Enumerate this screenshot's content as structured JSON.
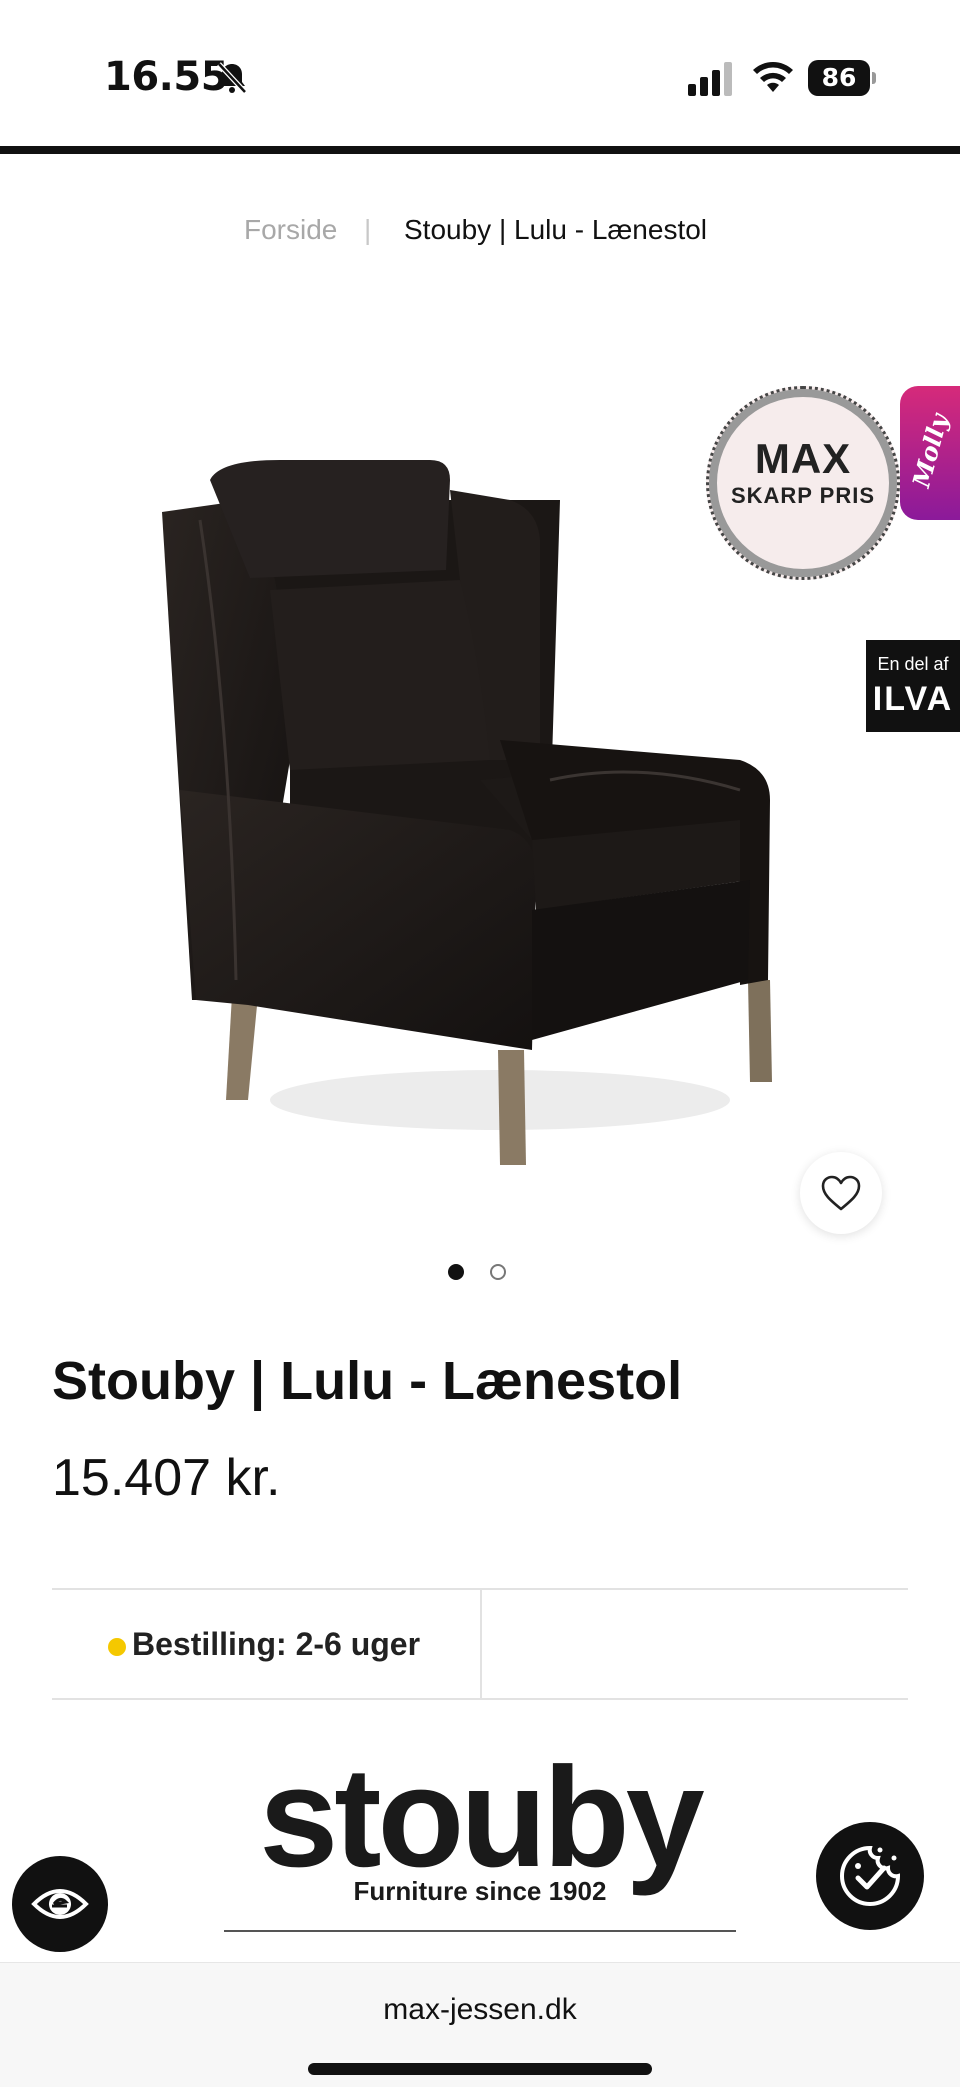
{
  "status_bar": {
    "time": "16.55",
    "battery": "86"
  },
  "breadcrumb": {
    "home": "Forside",
    "separator": "|",
    "current": "Stouby | Lulu - Lænestol"
  },
  "badges": {
    "max_big": "MAX",
    "max_small": "SKARP PRIS",
    "molly": "Molly",
    "ilva_small": "En del af",
    "ilva_big": "ILVA"
  },
  "gallery": {
    "image_count": 2,
    "active_index": 0
  },
  "product": {
    "title": "Stouby | Lulu - Lænestol",
    "price": "15.407 kr.",
    "delivery": "Bestilling: 2-6 uger",
    "delivery_status_color": "#f5c800"
  },
  "brand": {
    "name": "stouby",
    "tagline": "Furniture since 1902"
  },
  "browser": {
    "url": "max-jessen.dk"
  },
  "colors": {
    "molly_gradient_top": "#d62a7a",
    "molly_gradient_bottom": "#8b1a9a",
    "chair_leather": "#1f1a18",
    "chair_legs": "#8a7a64"
  }
}
